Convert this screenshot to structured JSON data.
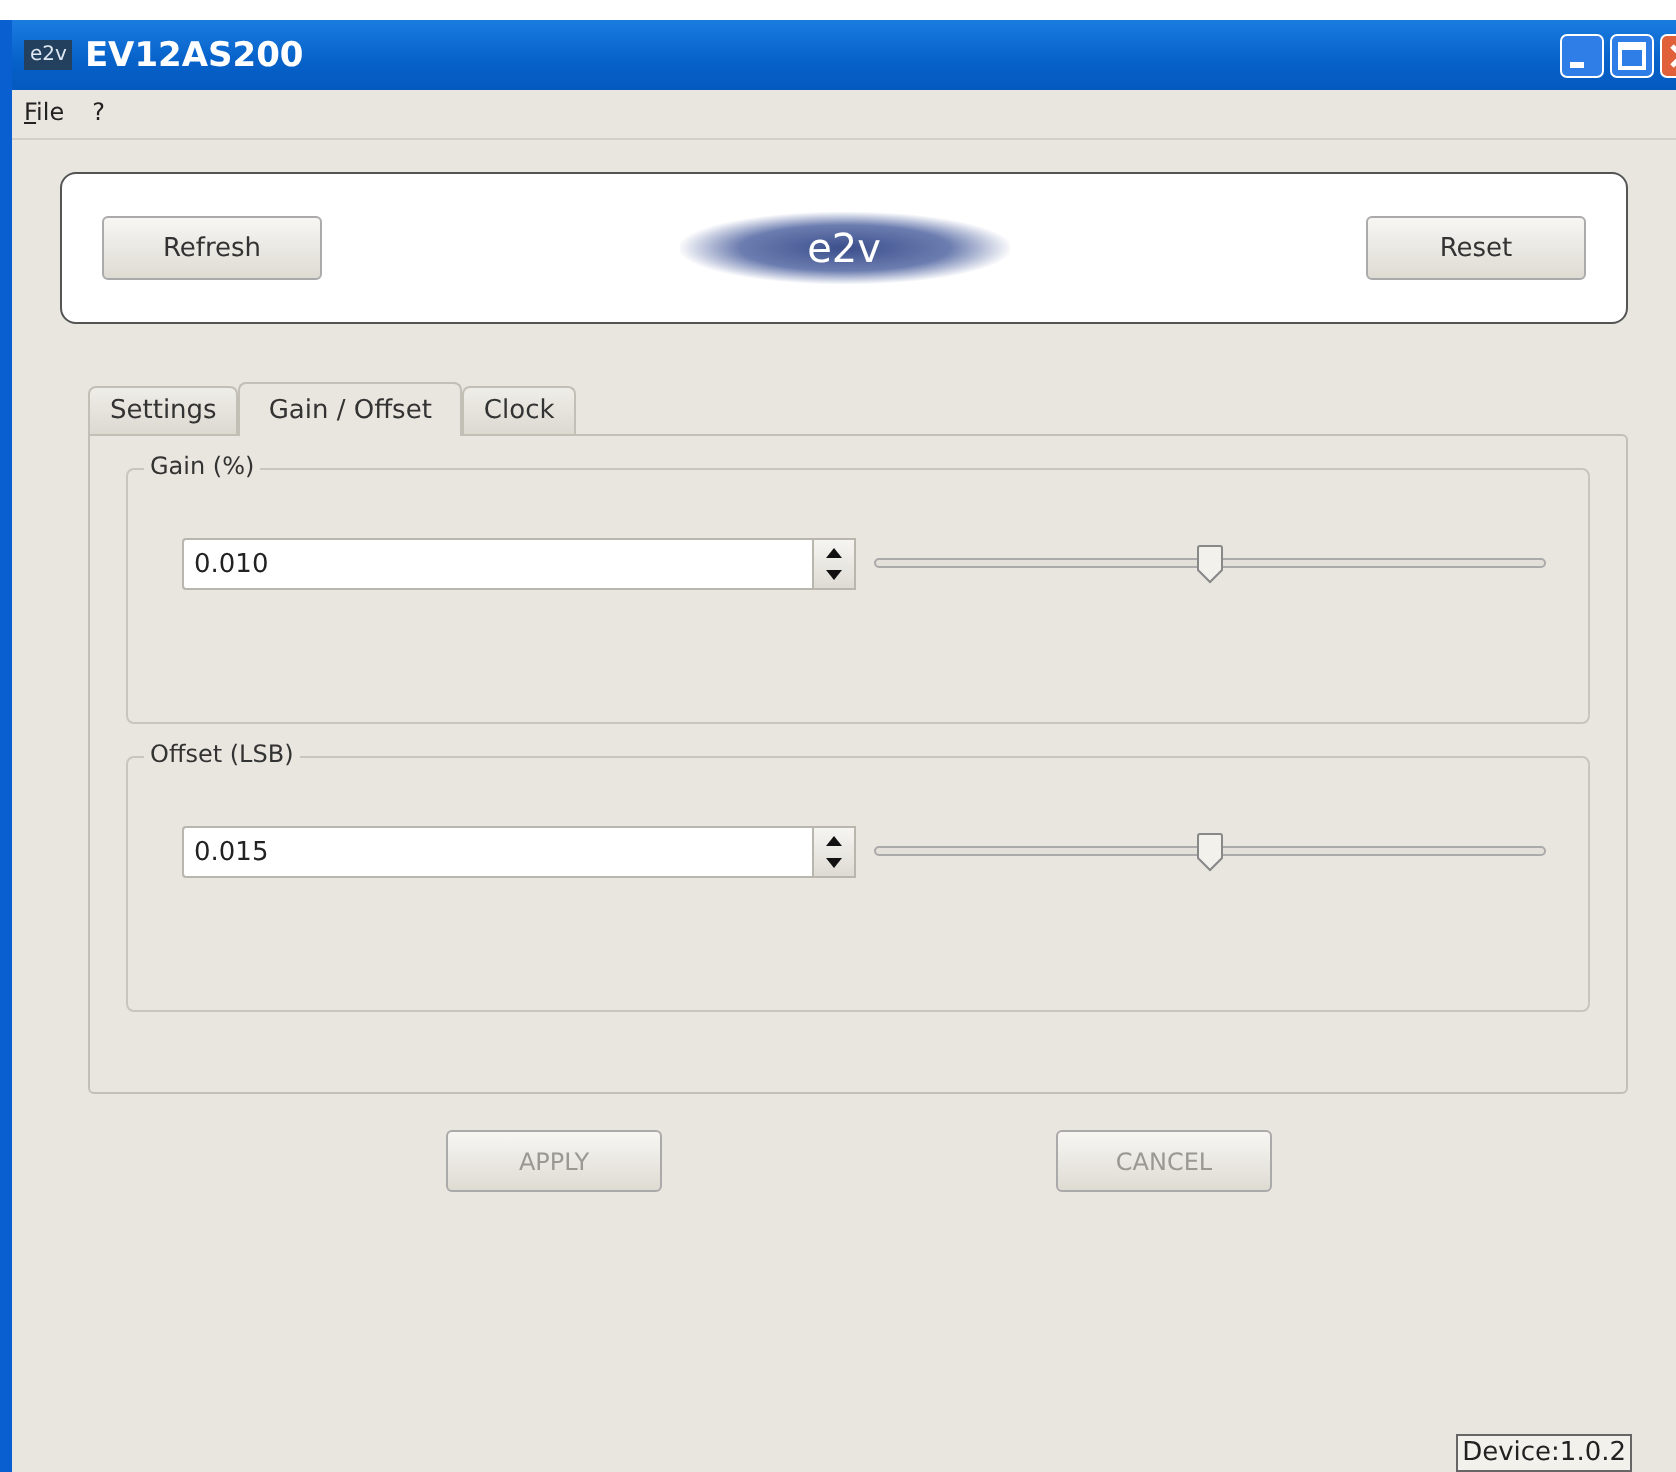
{
  "window": {
    "icon_text": "e2v",
    "title": "EV12AS200"
  },
  "menu": [
    {
      "label": "File"
    },
    {
      "label": "?"
    }
  ],
  "header": {
    "buttons": [
      {
        "label": "Refresh"
      },
      {
        "label": "Reset"
      }
    ],
    "logo": "e2v"
  },
  "tabs": [
    {
      "label": "Settings",
      "selected": false
    },
    {
      "label": "Gain / Offset",
      "selected": true
    },
    {
      "label": "Clock",
      "selected": false
    }
  ],
  "groups": [
    {
      "title": "Gain (%)",
      "value": "0.010",
      "level": 0.5
    },
    {
      "title": "Offset (LSB)",
      "value": "0.015",
      "level": 0.5
    }
  ],
  "actions": [
    {
      "label": "APPLY",
      "disabled": true
    },
    {
      "label": "CANCEL",
      "disabled": true
    }
  ],
  "status_bar": {
    "text": "Device:1.0.2"
  }
}
